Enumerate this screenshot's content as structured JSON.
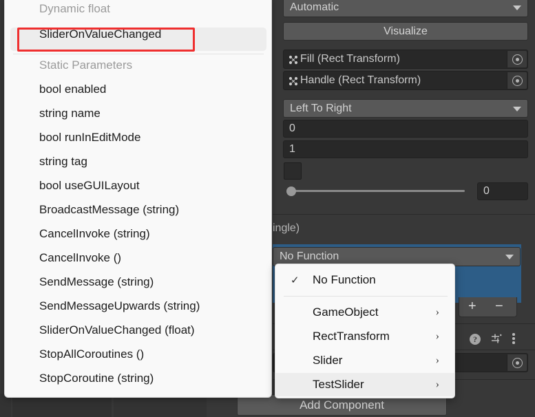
{
  "inspector": {
    "automatic_dropdown": "Automatic",
    "visualize_button": "Visualize",
    "fill_object_field": "Fill (Rect Transform)",
    "handle_object_field": "Handle (Rect Transform)",
    "direction_dropdown": "Left To Right",
    "min_value": "0",
    "max_value": "1",
    "slider_value": "0",
    "event_signature": "ingle)",
    "no_function_dropdown": "No Function",
    "add_button": "+",
    "remove_button": "−",
    "add_component_button": "Add Component",
    "accent_blue": "#2d5d87",
    "panel_bg": "#383838",
    "field_bg": "#282828",
    "control_bg": "#585858"
  },
  "function_popup": {
    "dynamic_header": "Dynamic float",
    "dynamic_items": [
      "SliderOnValueChanged"
    ],
    "static_header": "Static Parameters",
    "static_items": [
      "bool enabled",
      "string name",
      "bool runInEditMode",
      "string tag",
      "bool useGUILayout",
      "BroadcastMessage (string)",
      "CancelInvoke (string)",
      "CancelInvoke ()",
      "SendMessage (string)",
      "SendMessageUpwards (string)",
      "SliderOnValueChanged (float)",
      "StopAllCoroutines ()",
      "StopCoroutine (string)"
    ],
    "highlight_color": "#ef2f2f"
  },
  "context_menu": {
    "items": [
      {
        "label": "No Function",
        "checked": true,
        "submenu": false,
        "highlighted": false
      },
      {
        "label": "GameObject",
        "checked": false,
        "submenu": true,
        "highlighted": false
      },
      {
        "label": "RectTransform",
        "checked": false,
        "submenu": true,
        "highlighted": false
      },
      {
        "label": "Slider",
        "checked": false,
        "submenu": true,
        "highlighted": false
      },
      {
        "label": "TestSlider",
        "checked": false,
        "submenu": true,
        "highlighted": true
      }
    ],
    "check_glyph": "✓",
    "submenu_glyph": "›"
  }
}
